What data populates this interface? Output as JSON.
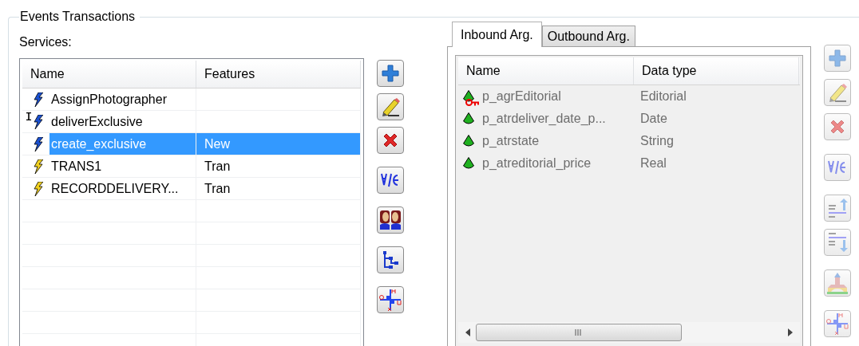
{
  "group": {
    "title": "Events Transactions"
  },
  "services": {
    "label": "Services:",
    "columns": [
      "Name",
      "Features"
    ],
    "rows": [
      {
        "kind": "event",
        "name": "AssignPhotographer",
        "features": "",
        "selected": false,
        "text_cursor": false
      },
      {
        "kind": "event",
        "name": "deliverExclusive",
        "features": "",
        "selected": false,
        "text_cursor": true
      },
      {
        "kind": "event",
        "name": "create_exclusive",
        "features": "New",
        "selected": true,
        "text_cursor": false
      },
      {
        "kind": "transaction",
        "name": "TRANS1",
        "features": "Tran",
        "selected": false,
        "text_cursor": false
      },
      {
        "kind": "transaction",
        "name": "RECORDDELIVERY...",
        "features": "Tran",
        "selected": false,
        "text_cursor": false
      }
    ]
  },
  "arguments": {
    "disabled": true,
    "tabs": [
      {
        "label": "Inbound Arg.",
        "selected": true
      },
      {
        "label": "Outbound Arg.",
        "selected": false
      }
    ],
    "columns": [
      "Name",
      "Data type"
    ],
    "rows": [
      {
        "name": "p_agrEditorial",
        "type": "Editorial",
        "key": true
      },
      {
        "name": "p_atrdeliver_date_p...",
        "type": "Date",
        "key": false
      },
      {
        "name": "p_atrstate",
        "type": "String",
        "key": false
      },
      {
        "name": "p_atreditorial_price",
        "type": "Real",
        "key": false
      }
    ]
  }
}
